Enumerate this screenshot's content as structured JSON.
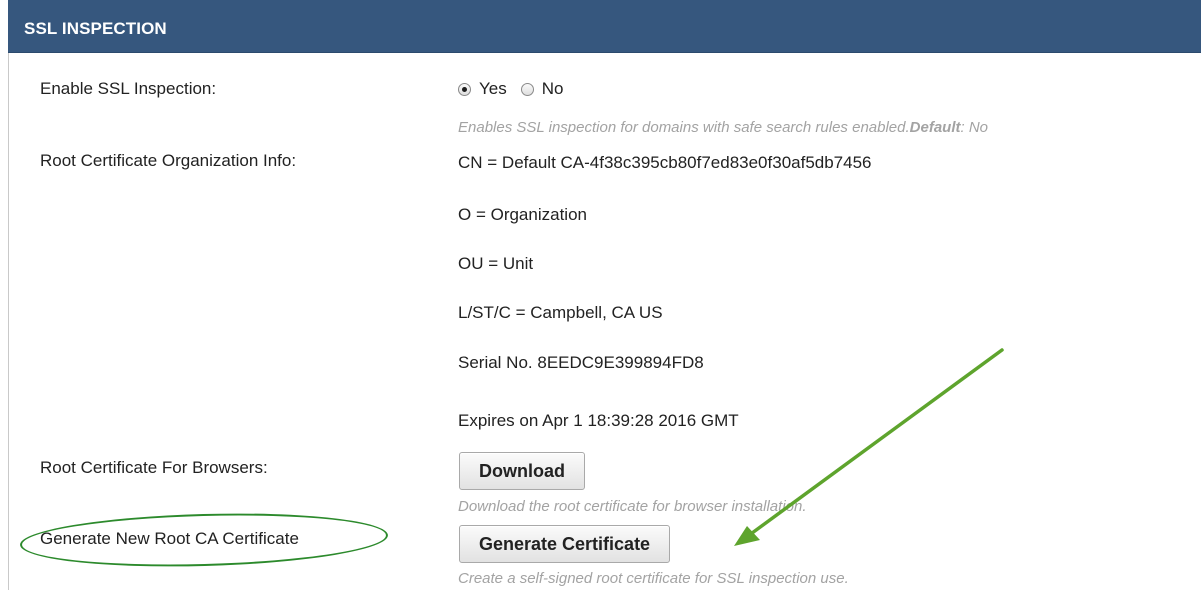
{
  "section": {
    "title": "SSL INSPECTION"
  },
  "ssl_inspection": {
    "label": "Enable SSL Inspection:",
    "options": [
      {
        "label": "Yes",
        "checked": true
      },
      {
        "label": "No",
        "checked": false
      }
    ],
    "hint_text": "Enables SSL inspection for domains with safe search rules enabled.",
    "hint_default_key": "Default",
    "hint_default_value": ": No"
  },
  "root_cert_info": {
    "label": "Root Certificate Organization Info:",
    "cn": "CN = Default CA-4f38c395cb80f7ed83e0f30af5db7456",
    "o": "O = Organization",
    "ou": "OU = Unit",
    "location": "L/ST/C = Campbell, CA US",
    "serial": "Serial No. 8EEDC9E399894FD8",
    "expires": "Expires on Apr 1 18:39:28 2016 GMT"
  },
  "browser_cert": {
    "label": "Root Certificate For Browsers:",
    "button_label": "Download",
    "hint": "Download the root certificate for browser installation."
  },
  "generate_cert": {
    "label": "Generate New Root CA Certificate",
    "button_label": "Generate Certificate",
    "hint": "Create a self-signed root certificate for SSL inspection use."
  },
  "colors": {
    "header_bg": "#36577e",
    "annotation_green": "#2c8a2c",
    "arrow_green": "#5ea42d"
  }
}
